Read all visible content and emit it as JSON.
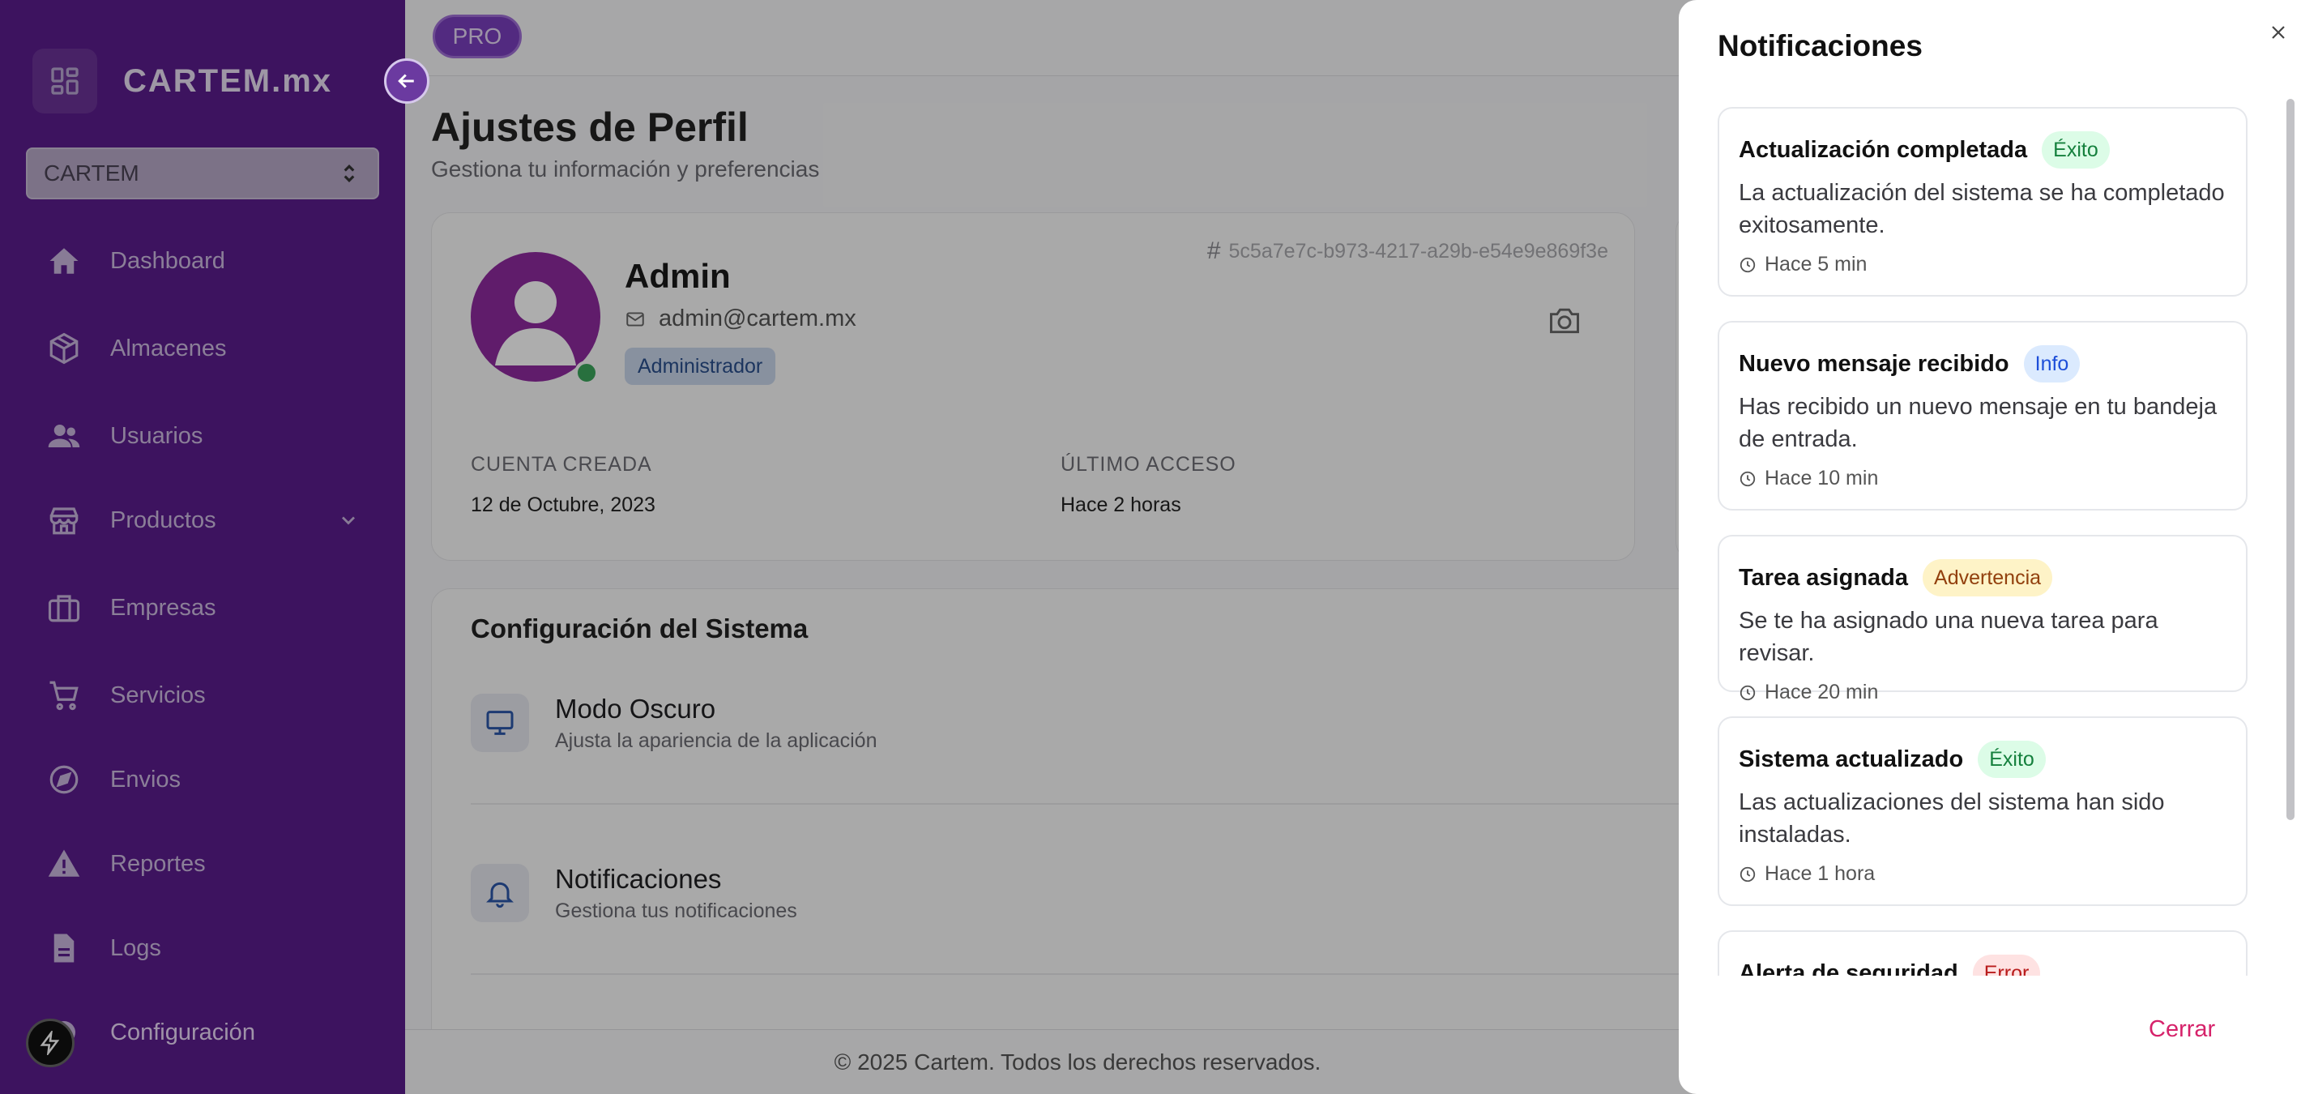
{
  "sidebar": {
    "brand": "CARTEM.mx",
    "company_select": "CARTEM",
    "items": [
      {
        "label": "Dashboard"
      },
      {
        "label": "Almacenes"
      },
      {
        "label": "Usuarios"
      },
      {
        "label": "Productos"
      },
      {
        "label": "Empresas"
      },
      {
        "label": "Servicios"
      },
      {
        "label": "Envios"
      },
      {
        "label": "Reportes"
      },
      {
        "label": "Logs"
      },
      {
        "label": "Configuración"
      }
    ]
  },
  "topbar": {
    "pro_badge": "PRO"
  },
  "page": {
    "title": "Ajustes de Perfil",
    "subtitle": "Gestiona tu información y preferencias"
  },
  "profile": {
    "name": "Admin",
    "email": "admin@cartem.mx",
    "role": "Administrador",
    "id": "5c5a7e7c-b973-4217-a29b-e54e9e869f3e",
    "created_label": "CUENTA CREADA",
    "created_value": "12 de Octubre, 2023",
    "last_access_label": "ÚLTIMO ACCESO",
    "last_access_value": "Hace 2 horas"
  },
  "config": {
    "title": "Configuración del Sistema",
    "rows": [
      {
        "title": "Modo Oscuro",
        "desc": "Ajusta la apariencia de la aplicación"
      },
      {
        "title": "Notificaciones",
        "desc": "Gestiona tus notificaciones"
      }
    ]
  },
  "footer": {
    "text": "© 2025 Cartem. Todos los derechos reservados."
  },
  "notifications_panel": {
    "title": "Notificaciones",
    "close_label": "Cerrar",
    "items": [
      {
        "title": "Actualización completada",
        "badge": "Éxito",
        "badge_type": "success",
        "message": "La actualización del sistema se ha completado exitosamente.",
        "time": "Hace 5 min"
      },
      {
        "title": "Nuevo mensaje recibido",
        "badge": "Info",
        "badge_type": "info",
        "message": "Has recibido un nuevo mensaje en tu bandeja de entrada.",
        "time": "Hace 10 min"
      },
      {
        "title": "Tarea asignada",
        "badge": "Advertencia",
        "badge_type": "warning",
        "message": "Se te ha asignado una nueva tarea para revisar.",
        "time": "Hace 20 min"
      },
      {
        "title": "Sistema actualizado",
        "badge": "Éxito",
        "badge_type": "success",
        "message": "Las actualizaciones del sistema han sido instaladas.",
        "time": "Hace 1 hora"
      },
      {
        "title": "Alerta de seguridad",
        "badge": "Error",
        "badge_type": "error",
        "message": "",
        "time": ""
      }
    ]
  },
  "colors": {
    "sidebar_bg": "#5a1c8c",
    "accent": "#7a3fbd",
    "success_bg": "#dcfce7",
    "success_fg": "#15803d",
    "info_bg": "#dbeafe",
    "info_fg": "#1d4ed8",
    "warning_bg": "#fef3c7",
    "warning_fg": "#92400e",
    "error_bg": "#fee2e2",
    "error_fg": "#b91c1c",
    "close_btn": "#d6226a"
  }
}
